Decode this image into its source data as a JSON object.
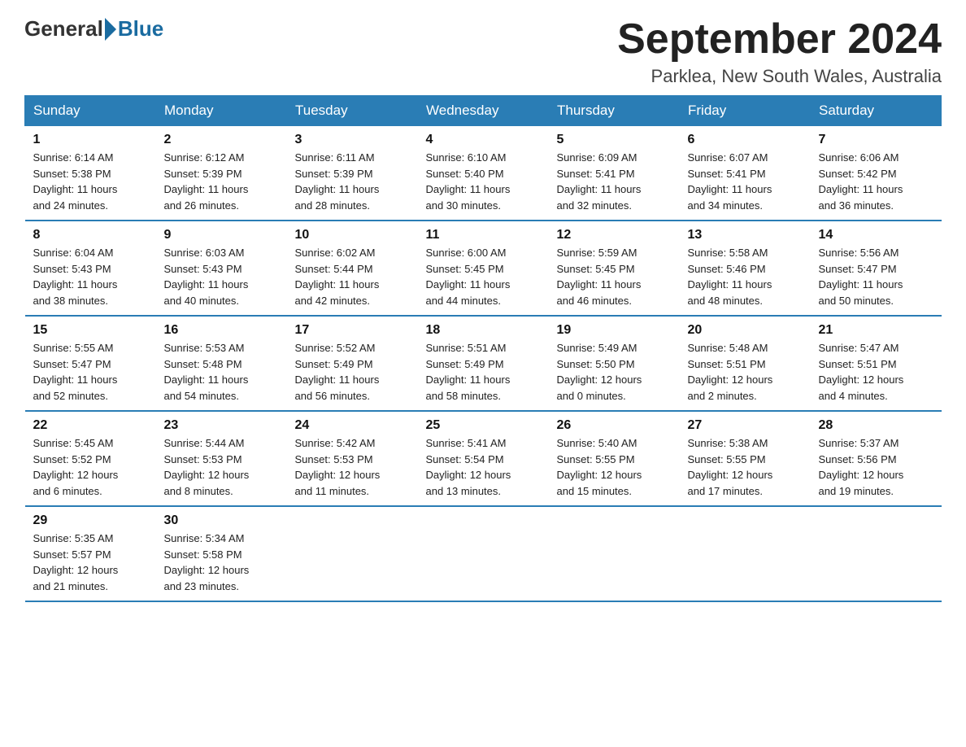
{
  "header": {
    "logo_general": "General",
    "logo_blue": "Blue",
    "month_title": "September 2024",
    "location": "Parklea, New South Wales, Australia"
  },
  "days_of_week": [
    "Sunday",
    "Monday",
    "Tuesday",
    "Wednesday",
    "Thursday",
    "Friday",
    "Saturday"
  ],
  "weeks": [
    [
      {
        "day": "1",
        "info": "Sunrise: 6:14 AM\nSunset: 5:38 PM\nDaylight: 11 hours\nand 24 minutes."
      },
      {
        "day": "2",
        "info": "Sunrise: 6:12 AM\nSunset: 5:39 PM\nDaylight: 11 hours\nand 26 minutes."
      },
      {
        "day": "3",
        "info": "Sunrise: 6:11 AM\nSunset: 5:39 PM\nDaylight: 11 hours\nand 28 minutes."
      },
      {
        "day": "4",
        "info": "Sunrise: 6:10 AM\nSunset: 5:40 PM\nDaylight: 11 hours\nand 30 minutes."
      },
      {
        "day": "5",
        "info": "Sunrise: 6:09 AM\nSunset: 5:41 PM\nDaylight: 11 hours\nand 32 minutes."
      },
      {
        "day": "6",
        "info": "Sunrise: 6:07 AM\nSunset: 5:41 PM\nDaylight: 11 hours\nand 34 minutes."
      },
      {
        "day": "7",
        "info": "Sunrise: 6:06 AM\nSunset: 5:42 PM\nDaylight: 11 hours\nand 36 minutes."
      }
    ],
    [
      {
        "day": "8",
        "info": "Sunrise: 6:04 AM\nSunset: 5:43 PM\nDaylight: 11 hours\nand 38 minutes."
      },
      {
        "day": "9",
        "info": "Sunrise: 6:03 AM\nSunset: 5:43 PM\nDaylight: 11 hours\nand 40 minutes."
      },
      {
        "day": "10",
        "info": "Sunrise: 6:02 AM\nSunset: 5:44 PM\nDaylight: 11 hours\nand 42 minutes."
      },
      {
        "day": "11",
        "info": "Sunrise: 6:00 AM\nSunset: 5:45 PM\nDaylight: 11 hours\nand 44 minutes."
      },
      {
        "day": "12",
        "info": "Sunrise: 5:59 AM\nSunset: 5:45 PM\nDaylight: 11 hours\nand 46 minutes."
      },
      {
        "day": "13",
        "info": "Sunrise: 5:58 AM\nSunset: 5:46 PM\nDaylight: 11 hours\nand 48 minutes."
      },
      {
        "day": "14",
        "info": "Sunrise: 5:56 AM\nSunset: 5:47 PM\nDaylight: 11 hours\nand 50 minutes."
      }
    ],
    [
      {
        "day": "15",
        "info": "Sunrise: 5:55 AM\nSunset: 5:47 PM\nDaylight: 11 hours\nand 52 minutes."
      },
      {
        "day": "16",
        "info": "Sunrise: 5:53 AM\nSunset: 5:48 PM\nDaylight: 11 hours\nand 54 minutes."
      },
      {
        "day": "17",
        "info": "Sunrise: 5:52 AM\nSunset: 5:49 PM\nDaylight: 11 hours\nand 56 minutes."
      },
      {
        "day": "18",
        "info": "Sunrise: 5:51 AM\nSunset: 5:49 PM\nDaylight: 11 hours\nand 58 minutes."
      },
      {
        "day": "19",
        "info": "Sunrise: 5:49 AM\nSunset: 5:50 PM\nDaylight: 12 hours\nand 0 minutes."
      },
      {
        "day": "20",
        "info": "Sunrise: 5:48 AM\nSunset: 5:51 PM\nDaylight: 12 hours\nand 2 minutes."
      },
      {
        "day": "21",
        "info": "Sunrise: 5:47 AM\nSunset: 5:51 PM\nDaylight: 12 hours\nand 4 minutes."
      }
    ],
    [
      {
        "day": "22",
        "info": "Sunrise: 5:45 AM\nSunset: 5:52 PM\nDaylight: 12 hours\nand 6 minutes."
      },
      {
        "day": "23",
        "info": "Sunrise: 5:44 AM\nSunset: 5:53 PM\nDaylight: 12 hours\nand 8 minutes."
      },
      {
        "day": "24",
        "info": "Sunrise: 5:42 AM\nSunset: 5:53 PM\nDaylight: 12 hours\nand 11 minutes."
      },
      {
        "day": "25",
        "info": "Sunrise: 5:41 AM\nSunset: 5:54 PM\nDaylight: 12 hours\nand 13 minutes."
      },
      {
        "day": "26",
        "info": "Sunrise: 5:40 AM\nSunset: 5:55 PM\nDaylight: 12 hours\nand 15 minutes."
      },
      {
        "day": "27",
        "info": "Sunrise: 5:38 AM\nSunset: 5:55 PM\nDaylight: 12 hours\nand 17 minutes."
      },
      {
        "day": "28",
        "info": "Sunrise: 5:37 AM\nSunset: 5:56 PM\nDaylight: 12 hours\nand 19 minutes."
      }
    ],
    [
      {
        "day": "29",
        "info": "Sunrise: 5:35 AM\nSunset: 5:57 PM\nDaylight: 12 hours\nand 21 minutes."
      },
      {
        "day": "30",
        "info": "Sunrise: 5:34 AM\nSunset: 5:58 PM\nDaylight: 12 hours\nand 23 minutes."
      },
      {
        "day": "",
        "info": ""
      },
      {
        "day": "",
        "info": ""
      },
      {
        "day": "",
        "info": ""
      },
      {
        "day": "",
        "info": ""
      },
      {
        "day": "",
        "info": ""
      }
    ]
  ]
}
